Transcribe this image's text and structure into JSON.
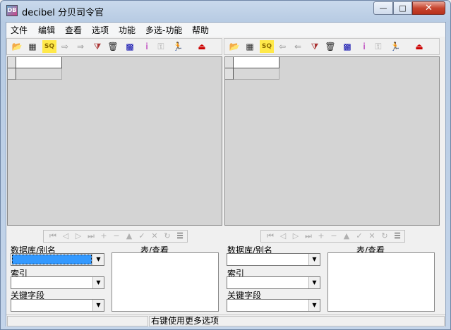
{
  "window": {
    "title": "decibel 分贝司令官",
    "app_icon_text": "DB"
  },
  "controls": {
    "minimize": "—",
    "maximize": "□",
    "close": "✕"
  },
  "menu": [
    "文件",
    "编辑",
    "查看",
    "选项",
    "功能",
    "多选-功能",
    "帮助"
  ],
  "toolbar_icons": [
    {
      "name": "open-folder-icon",
      "glyph": "📂",
      "color": "#c8a000"
    },
    {
      "name": "table-icon",
      "glyph": "▦",
      "color": "#333"
    },
    {
      "name": "sql-icon",
      "glyph": "SQ",
      "color": "#8a6a00"
    },
    {
      "name": "arrow-right-icon",
      "glyph": "⇨",
      "color": "#999"
    },
    {
      "name": "export-icon",
      "glyph": "⇒",
      "color": "#999"
    },
    {
      "name": "filter-icon",
      "glyph": "⧩",
      "color": "#a33"
    },
    {
      "name": "trash-icon",
      "glyph": "🗑",
      "color": "#222"
    },
    {
      "name": "grid-icon",
      "glyph": "▩",
      "color": "#00a"
    },
    {
      "name": "info-icon",
      "glyph": "i",
      "color": "#a0a"
    },
    {
      "name": "key-icon",
      "glyph": "⚿",
      "color": "#aaa"
    },
    {
      "name": "run-icon",
      "glyph": "🏃",
      "color": "#0a0"
    },
    {
      "name": "exit-icon",
      "glyph": "⏏",
      "color": "#c00"
    }
  ],
  "toolbar_icons_right": [
    {
      "name": "open-folder-icon",
      "glyph": "📂",
      "color": "#c8a000"
    },
    {
      "name": "table-icon",
      "glyph": "▦",
      "color": "#333"
    },
    {
      "name": "sql-icon",
      "glyph": "SQ",
      "color": "#8a6a00"
    },
    {
      "name": "arrow-left-icon",
      "glyph": "⇦",
      "color": "#999"
    },
    {
      "name": "import-icon",
      "glyph": "⇐",
      "color": "#999"
    },
    {
      "name": "filter-icon",
      "glyph": "⧩",
      "color": "#a33"
    },
    {
      "name": "trash-icon",
      "glyph": "🗑",
      "color": "#222"
    },
    {
      "name": "grid-icon",
      "glyph": "▩",
      "color": "#00a"
    },
    {
      "name": "info-icon",
      "glyph": "i",
      "color": "#a0a"
    },
    {
      "name": "key-icon",
      "glyph": "⚿",
      "color": "#aaa"
    },
    {
      "name": "run-icon",
      "glyph": "🏃",
      "color": "#0a0"
    },
    {
      "name": "exit-icon",
      "glyph": "⏏",
      "color": "#c00"
    }
  ],
  "navigator": [
    "⏮",
    "◁",
    "▷",
    "⏭",
    "+",
    "−",
    "▲",
    "✓",
    "✕",
    "↻",
    "☰"
  ],
  "left_pane": {
    "db_label": "数据库/别名",
    "table_label": "表/查看",
    "index_label": "索引",
    "key_label": "关键字段",
    "db_value": "",
    "index_value": "",
    "key_value": ""
  },
  "right_pane": {
    "db_label": "数据库/别名",
    "table_label": "表/查看",
    "index_label": "索引",
    "key_label": "关键字段",
    "db_value": "",
    "index_value": "",
    "key_value": ""
  },
  "status": {
    "hint": "右键使用更多选项"
  },
  "colors": {
    "selection": "#3399ff",
    "close_button": "#c7452f"
  }
}
